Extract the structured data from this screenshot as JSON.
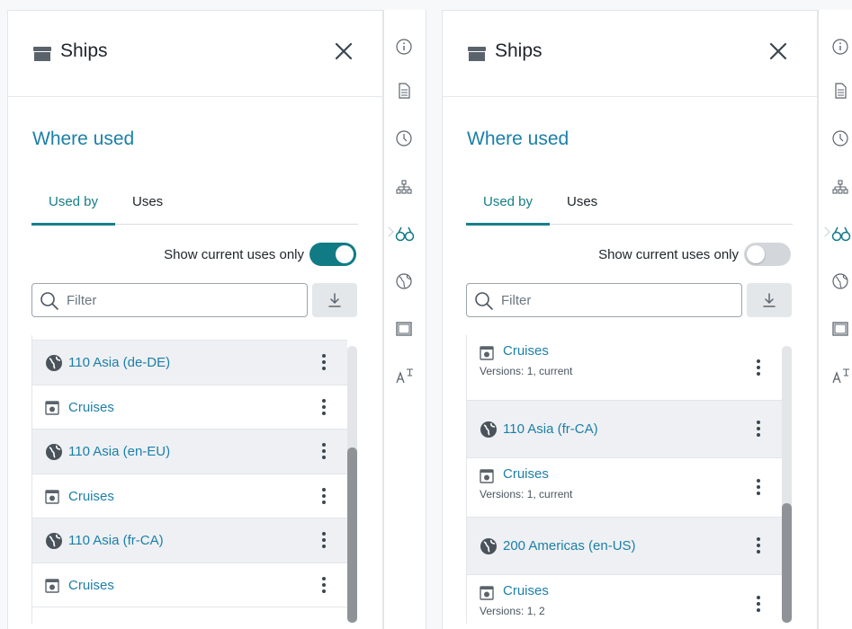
{
  "colors": {
    "accent": "#117b85",
    "link": "#1b7fa8",
    "row_shaded": "#eef0f3"
  },
  "panels": [
    {
      "title": "Ships",
      "title_icon": "box-icon",
      "section_title": "Where used",
      "tabs": [
        {
          "label": "Used by",
          "active": true
        },
        {
          "label": "Uses",
          "active": false
        }
      ],
      "toggle": {
        "label": "Show current uses only",
        "on": true
      },
      "filter": {
        "placeholder": "Filter",
        "value": ""
      },
      "rows": [
        {
          "icon": "page-icon",
          "label": "Cruises",
          "sub": ""
        },
        {
          "icon": "globe-icon",
          "label": "110 Asia (de-DE)",
          "sub": ""
        },
        {
          "icon": "page-icon",
          "label": "Cruises",
          "sub": ""
        },
        {
          "icon": "globe-icon",
          "label": "110 Asia (en-EU)",
          "sub": ""
        },
        {
          "icon": "page-icon",
          "label": "Cruises",
          "sub": ""
        },
        {
          "icon": "globe-icon",
          "label": "110 Asia (fr-CA)",
          "sub": ""
        },
        {
          "icon": "page-icon",
          "label": "Cruises",
          "sub": ""
        }
      ]
    },
    {
      "title": "Ships",
      "title_icon": "box-icon",
      "section_title": "Where used",
      "tabs": [
        {
          "label": "Used by",
          "active": true
        },
        {
          "label": "Uses",
          "active": false
        }
      ],
      "toggle": {
        "label": "Show current uses only",
        "on": false
      },
      "filter": {
        "placeholder": "Filter",
        "value": ""
      },
      "rows": [
        {
          "icon": "page-icon",
          "label": "Cruises",
          "sub": "Versions: 1, current"
        },
        {
          "icon": "globe-icon",
          "label": "110 Asia (fr-CA)",
          "sub": ""
        },
        {
          "icon": "page-icon",
          "label": "Cruises",
          "sub": "Versions: 1, current"
        },
        {
          "icon": "globe-icon",
          "label": "200 Americas (en-US)",
          "sub": ""
        },
        {
          "icon": "page-icon",
          "label": "Cruises",
          "sub": "Versions: 1, 2"
        }
      ]
    }
  ],
  "rail_icons": [
    "info-icon",
    "document-icon",
    "history-icon",
    "sitemap-icon",
    "binoculars-icon",
    "globe-outline-icon",
    "window-icon",
    "translate-icon"
  ]
}
